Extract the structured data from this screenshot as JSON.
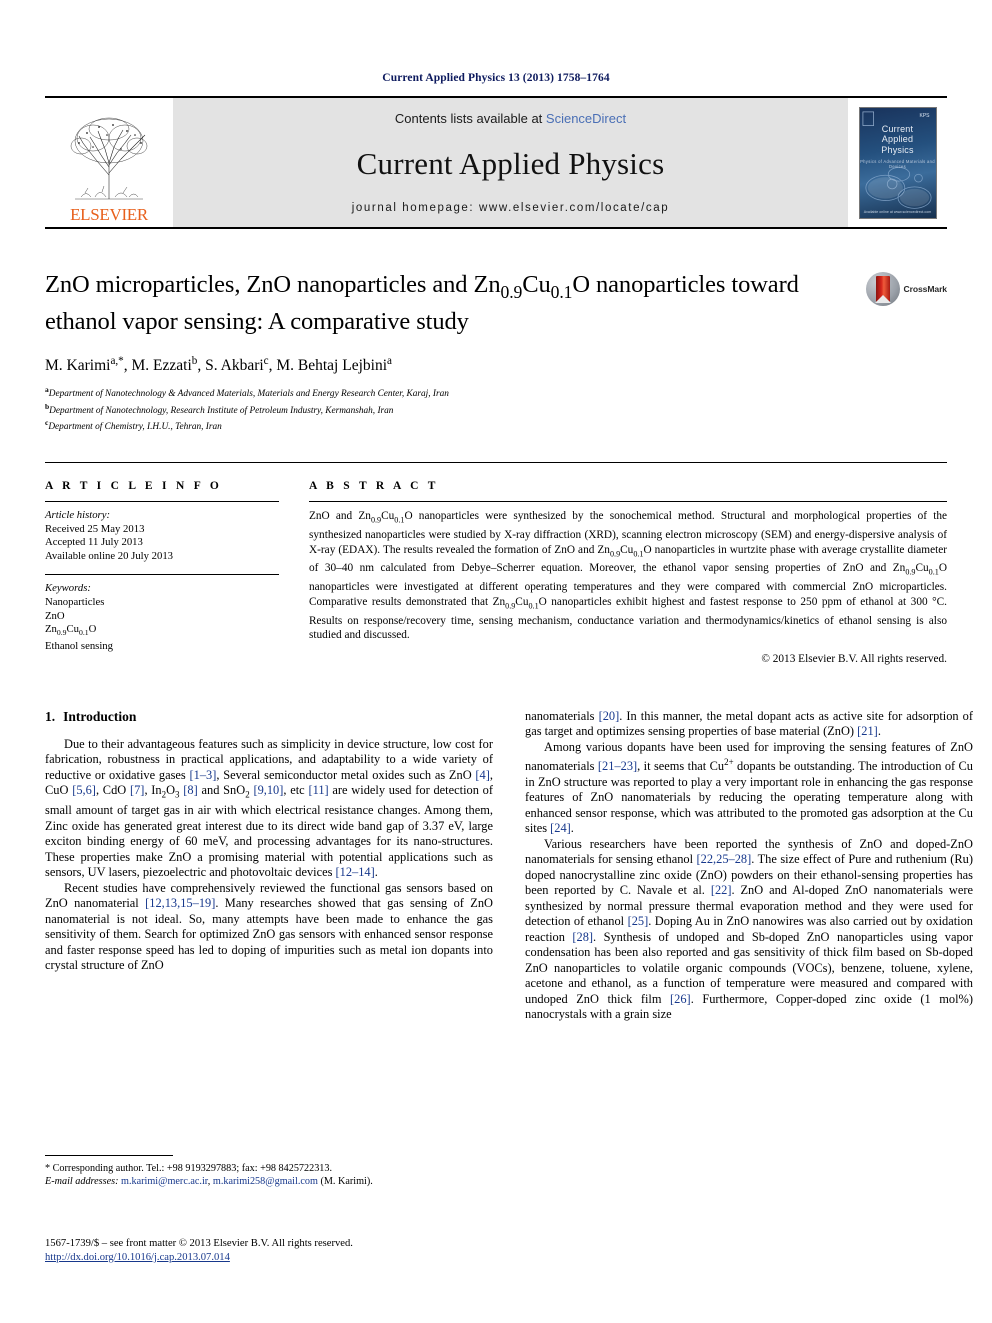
{
  "running_head": "Current Applied Physics 13 (2013) 1758–1764",
  "masthead": {
    "contents_prefix": "Contents lists available at ",
    "contents_link": "ScienceDirect",
    "journal_name": "Current Applied Physics",
    "homepage": "journal homepage: www.elsevier.com/locate/cap",
    "publisher_logo_text": "ELSEVIER",
    "cover": {
      "line1": "Current",
      "line2": "Applied",
      "line3": "Physics",
      "subtitle": "Physics of Advanced Materials and Devices",
      "corner_label": "KPS",
      "footer": "Available online at www.sciencedirect.com"
    }
  },
  "title": {
    "line1_a": "ZnO microparticles, ZnO nanoparticles and Zn",
    "line1_sub1": "0.9",
    "line1_b": "Cu",
    "line1_sub2": "0.1",
    "line1_c": "O nanoparticles",
    "line2": "toward ethanol vapor sensing: A comparative study",
    "full": "ZnO microparticles, ZnO nanoparticles and Zn0.9Cu0.1O nanoparticles toward ethanol vapor sensing: A comparative study"
  },
  "crossmark_label": "CrossMark",
  "authors": "M. Karimi a,*, M. Ezzati b, S. Akbari c, M. Behtaj Lejbini a",
  "affiliations": [
    {
      "marker": "a",
      "text": "Department of Nanotechnology & Advanced Materials, Materials and Energy Research Center, Karaj, Iran"
    },
    {
      "marker": "b",
      "text": "Department of Nanotechnology, Research Institute of Petroleum Industry, Kermanshah, Iran"
    },
    {
      "marker": "c",
      "text": "Department of Chemistry, I.H.U., Tehran, Iran"
    }
  ],
  "article_info": {
    "heading": "A R T I C L E   I N F O",
    "history_label": "Article history:",
    "history": [
      "Received 25 May 2013",
      "Accepted 11 July 2013",
      "Available online 20 July 2013"
    ],
    "keywords_label": "Keywords:",
    "keywords": [
      "Nanoparticles",
      "ZnO",
      "Zn0.9Cu0.1O",
      "Ethanol sensing"
    ]
  },
  "abstract": {
    "heading": "A B S T R A C T",
    "text": "ZnO and Zn0.9Cu0.1O nanoparticles were synthesized by the sonochemical method. Structural and morphological properties of the synthesized nanoparticles were studied by X-ray diffraction (XRD), scanning electron microscopy (SEM) and energy-dispersive analysis of X-ray (EDAX). The results revealed the formation of ZnO and Zn0.9Cu0.1O nanoparticles in wurtzite phase with average crystallite diameter of 30–40 nm calculated from Debye–Scherrer equation. Moreover, the ethanol vapor sensing properties of ZnO and Zn0.9Cu0.1O nanoparticles were investigated at different operating temperatures and they were compared with commercial ZnO microparticles. Comparative results demonstrated that Zn0.9Cu0.1O nanoparticles exhibit highest and fastest response to 250 ppm of ethanol at 300 °C. Results on response/recovery time, sensing mechanism, conductance variation and thermodynamics/kinetics of ethanol sensing is also studied and discussed.",
    "copyright": "© 2013 Elsevier B.V. All rights reserved."
  },
  "section": {
    "number": "1.",
    "heading": "Introduction"
  },
  "body": {
    "left": [
      "Due to their advantageous features such as simplicity in device structure, low cost for fabrication, robustness in practical applications, and adaptability to a wide variety of reductive or oxidative gases [1–3], Several semiconductor metal oxides such as ZnO [4], CuO [5,6], CdO [7], In2O3 [8] and SnO2 [9,10], etc [11] are widely used for detection of small amount of target gas in air with which electrical resistance changes. Among them, Zinc oxide has generated great interest due to its direct wide band gap of 3.37 eV, large exciton binding energy of 60 meV, and processing advantages for its nano-structures. These properties make ZnO a promising material with potential applications such as sensors, UV lasers, piezoelectric and photovoltaic devices [12–14].",
      "Recent studies have comprehensively reviewed the functional gas sensors based on ZnO nanomaterial [12,13,15–19]. Many researches showed that gas sensing of ZnO nanomaterial is not ideal. So, many attempts have been made to enhance the gas sensitivity of them. Search for optimized ZnO gas sensors with enhanced sensor response and faster response speed has led to doping of impurities such as metal ion dopants into crystal structure of ZnO"
    ],
    "right": [
      "nanomaterials [20]. In this manner, the metal dopant acts as active site for adsorption of gas target and optimizes sensing properties of base material (ZnO) [21].",
      "Among various dopants have been used for improving the sensing features of ZnO nanomaterials [21–23], it seems that Cu2+ dopants be outstanding. The introduction of Cu in ZnO structure was reported to play a very important role in enhancing the gas response features of ZnO nanomaterials by reducing the operating temperature along with enhanced sensor response, which was attributed to the promoted gas adsorption at the Cu sites [24].",
      "Various researchers have been reported the synthesis of ZnO and doped-ZnO nanomaterials for sensing ethanol [22,25–28]. The size effect of Pure and ruthenium (Ru) doped nanocrystalline zinc oxide (ZnO) powders on their ethanol-sensing properties has been reported by C. Navale et al. [22]. ZnO and Al-doped ZnO nanomaterials were synthesized by normal pressure thermal evaporation method and they were used for detection of ethanol [25]. Doping Au in ZnO nanowires was also carried out by oxidation reaction [28]. Synthesis of undoped and Sb-doped ZnO nanoparticles using vapor condensation has been also reported and gas sensitivity of thick film based on Sb-doped ZnO nanoparticles to volatile organic compounds (VOCs), benzene, toluene, xylene, acetone and ethanol, as a function of temperature were measured and compared with undoped ZnO thick film [26]. Furthermore, Copper-doped zinc oxide (1 mol%) nanocrystals with a grain size"
    ]
  },
  "footnote": {
    "corresponding": "* Corresponding author. Tel.: +98 9193297883; fax: +98 8425722313.",
    "email_label": "E-mail addresses:",
    "email1": "m.karimi@merc.ac.ir",
    "email_sep": ", ",
    "email2": "m.karimi258@gmail.com",
    "email_suffix": " (M. Karimi)."
  },
  "imprint": {
    "line1": "1567-1739/$ – see front matter © 2013 Elsevier B.V. All rights reserved.",
    "doi": "http://dx.doi.org/10.1016/j.cap.2013.07.014"
  }
}
